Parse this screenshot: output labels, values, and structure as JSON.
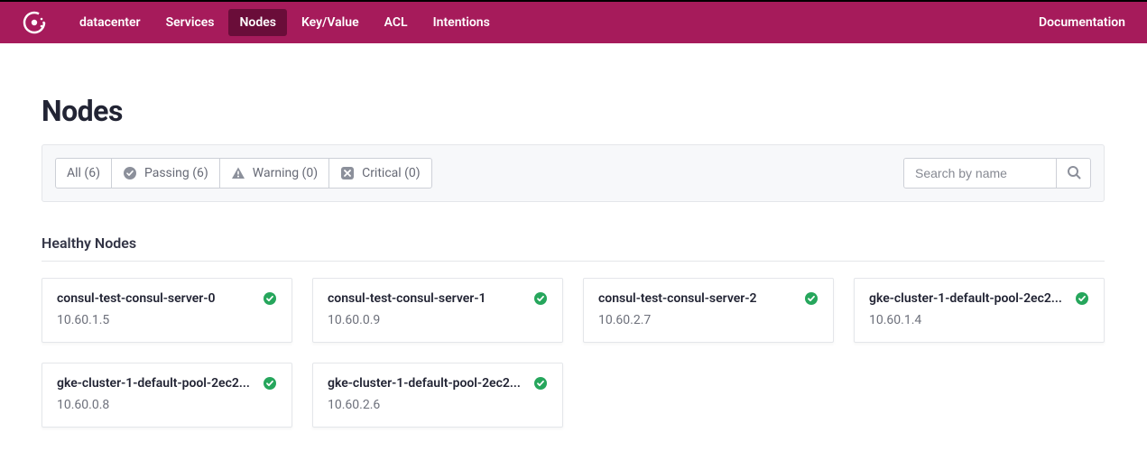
{
  "nav": {
    "datacenter": "datacenter",
    "items": [
      "Services",
      "Nodes",
      "Key/Value",
      "ACL",
      "Intentions"
    ],
    "active": "Nodes",
    "right": "Documentation"
  },
  "page": {
    "title": "Nodes",
    "section_title": "Healthy Nodes"
  },
  "filters": {
    "all": "All (6)",
    "passing": "Passing (6)",
    "warning": "Warning (0)",
    "critical": "Critical (0)"
  },
  "search": {
    "placeholder": "Search by name"
  },
  "nodes": [
    {
      "name": "consul-test-consul-server-0",
      "ip": "10.60.1.5",
      "status": "passing"
    },
    {
      "name": "consul-test-consul-server-1",
      "ip": "10.60.0.9",
      "status": "passing"
    },
    {
      "name": "consul-test-consul-server-2",
      "ip": "10.60.2.7",
      "status": "passing"
    },
    {
      "name": "gke-cluster-1-default-pool-2ec2...",
      "ip": "10.60.1.4",
      "status": "passing"
    },
    {
      "name": "gke-cluster-1-default-pool-2ec2...",
      "ip": "10.60.0.8",
      "status": "passing"
    },
    {
      "name": "gke-cluster-1-default-pool-2ec2...",
      "ip": "10.60.2.6",
      "status": "passing"
    }
  ],
  "colors": {
    "brand": "#a61b5b",
    "success": "#26a65c",
    "grey_icon": "#8c909b"
  }
}
